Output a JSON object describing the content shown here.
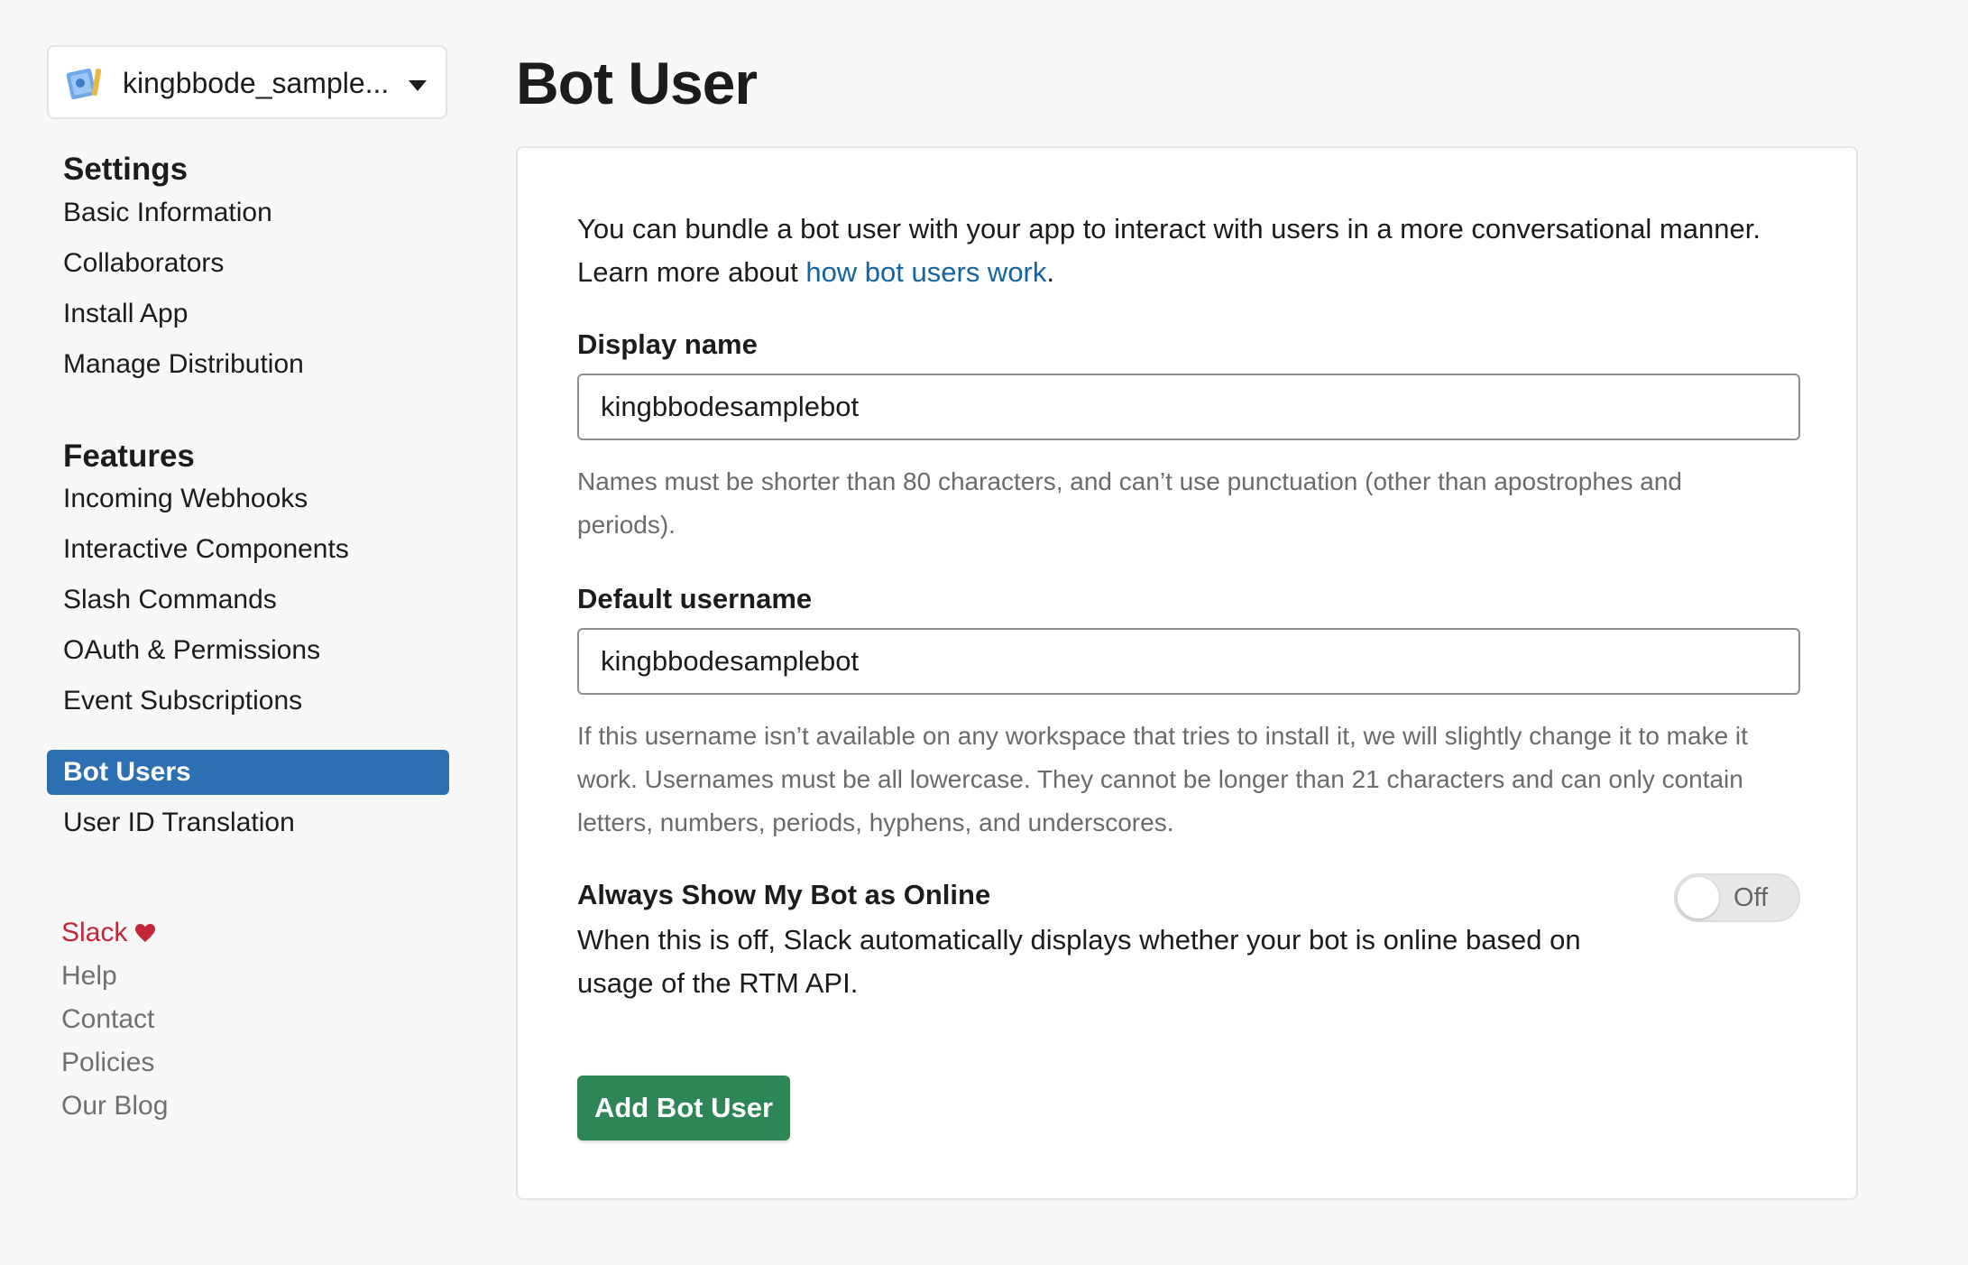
{
  "app_selector": {
    "name": "kingbbode_sample...",
    "icon": "app-icon",
    "caret": "chevron-down-icon"
  },
  "sidebar": {
    "settings_heading": "Settings",
    "settings_items": [
      {
        "label": "Basic Information"
      },
      {
        "label": "Collaborators"
      },
      {
        "label": "Install App"
      },
      {
        "label": "Manage Distribution"
      }
    ],
    "features_heading": "Features",
    "features_items": [
      {
        "label": "Incoming Webhooks"
      },
      {
        "label": "Interactive Components"
      },
      {
        "label": "Slash Commands"
      },
      {
        "label": "OAuth & Permissions"
      },
      {
        "label": "Event Subscriptions"
      },
      {
        "label": "Bot Users",
        "active": true
      },
      {
        "label": "User ID Translation"
      }
    ],
    "active_color": "#2c6fb3"
  },
  "footer": {
    "brand": "Slack",
    "links": [
      {
        "label": "Help"
      },
      {
        "label": "Contact"
      },
      {
        "label": "Policies"
      },
      {
        "label": "Our Blog"
      }
    ]
  },
  "page": {
    "title": "Bot User",
    "intro_text": "You can bundle a bot user with your app to interact with users in a more conversational manner. Learn more about ",
    "intro_link": "how bot users work",
    "intro_end": "."
  },
  "display_name": {
    "label": "Display name",
    "value": "kingbbodesamplebot",
    "hint": "Names must be shorter than 80 characters, and can’t use punctuation (other than apostrophes and periods)."
  },
  "default_username": {
    "label": "Default username",
    "value": "kingbbodesamplebot",
    "hint": "If this username isn’t available on any workspace that tries to install it, we will slightly change it to make it work. Usernames must be all lowercase. They cannot be longer than 21 characters and can only contain letters, numbers, periods, hyphens, and underscores."
  },
  "online_toggle": {
    "label": "Always Show My Bot as Online",
    "description": "When this is off, Slack automatically displays whether your bot is online based on usage of the RTM API.",
    "state": "Off"
  },
  "add_button": {
    "label": "Add Bot User",
    "color": "#2e8555"
  }
}
